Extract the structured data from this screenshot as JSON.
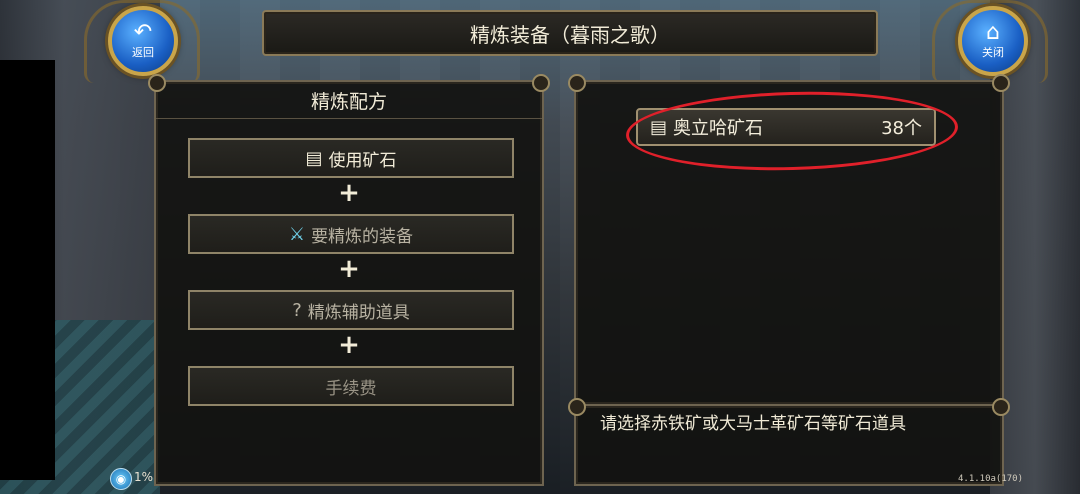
{
  "title": "精炼装备（暮雨之歌）",
  "buttons": {
    "back": {
      "label": "返回",
      "icon": "back-arrow-icon"
    },
    "close": {
      "label": "关闭",
      "icon": "home-icon"
    }
  },
  "recipe": {
    "header": "精炼配方",
    "slots": [
      {
        "label": "使用矿石",
        "icon": "ore-icon"
      },
      {
        "label": "要精炼的装备",
        "icon": "sword-icon"
      },
      {
        "label": "精炼辅助道具",
        "icon": "question-icon"
      },
      {
        "label": "手续费",
        "icon": ""
      }
    ],
    "plus": "+"
  },
  "ore_list": [
    {
      "name": "奥立哈矿石",
      "quantity": "38个",
      "icon": "ore-icon"
    }
  ],
  "hint": "请选择赤铁矿或大马士革矿石等矿石道具",
  "status": {
    "percent": "1%"
  },
  "version": "4.1.10a(170)",
  "colors": {
    "highlight": "#e0202a",
    "accent_blue": "#1a5fc4",
    "gold_border": "#c9a54a"
  }
}
